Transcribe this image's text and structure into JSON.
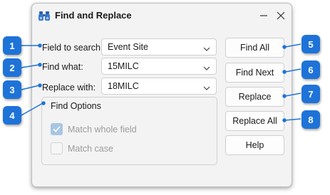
{
  "dialog": {
    "title": "Find and Replace",
    "title_icon": "binoculars-icon",
    "minimize_icon": "minimize-icon",
    "close_icon": "close-icon"
  },
  "fields": {
    "field_to_search": {
      "label": "Field to search:",
      "value": "Event Site"
    },
    "find_what": {
      "label": "Find what:",
      "value": "15MILC"
    },
    "replace_with": {
      "label": "Replace with:",
      "value": "18MILC"
    }
  },
  "find_options": {
    "title": "Find Options",
    "match_whole_field": {
      "label": "Match whole field",
      "checked": true
    },
    "match_case": {
      "label": "Match case",
      "checked": false
    }
  },
  "buttons": {
    "find_all": "Find All",
    "find_next": "Find Next",
    "replace": "Replace",
    "replace_all": "Replace All",
    "help": "Help"
  },
  "callouts": [
    "1",
    "2",
    "3",
    "4",
    "5",
    "6",
    "7",
    "8"
  ],
  "colors": {
    "callout_blue": "#1e73d8",
    "checkbox_checked": "#a7c6e3"
  }
}
